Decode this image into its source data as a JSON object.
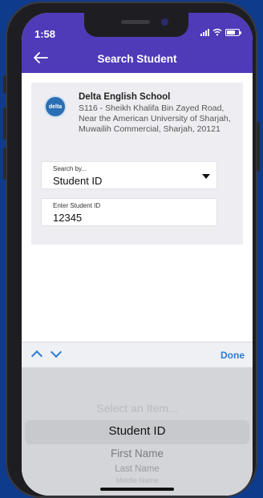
{
  "status_bar": {
    "time": "1:58"
  },
  "header": {
    "title": "Search Student"
  },
  "school": {
    "logo_text": "delta",
    "name": "Delta English School",
    "address": "S116 - Sheikh Khalifa Bin Zayed Road, Near the American University of Sharjah, Muwailih Commercial, Sharjah, 20121"
  },
  "form": {
    "search_by": {
      "label": "Search by...",
      "value": "Student ID"
    },
    "student_id": {
      "label": "Enter Student ID",
      "value": "12345"
    }
  },
  "accessory": {
    "done_label": "Done"
  },
  "picker": {
    "items": [
      "Select an Item...",
      "Student ID",
      "First Name",
      "Last Name",
      "Middle Name"
    ],
    "selected": "Student ID"
  },
  "colors": {
    "header": "#4f3ab8",
    "accent": "#2f7ad6",
    "background": "#0f3b8c"
  }
}
